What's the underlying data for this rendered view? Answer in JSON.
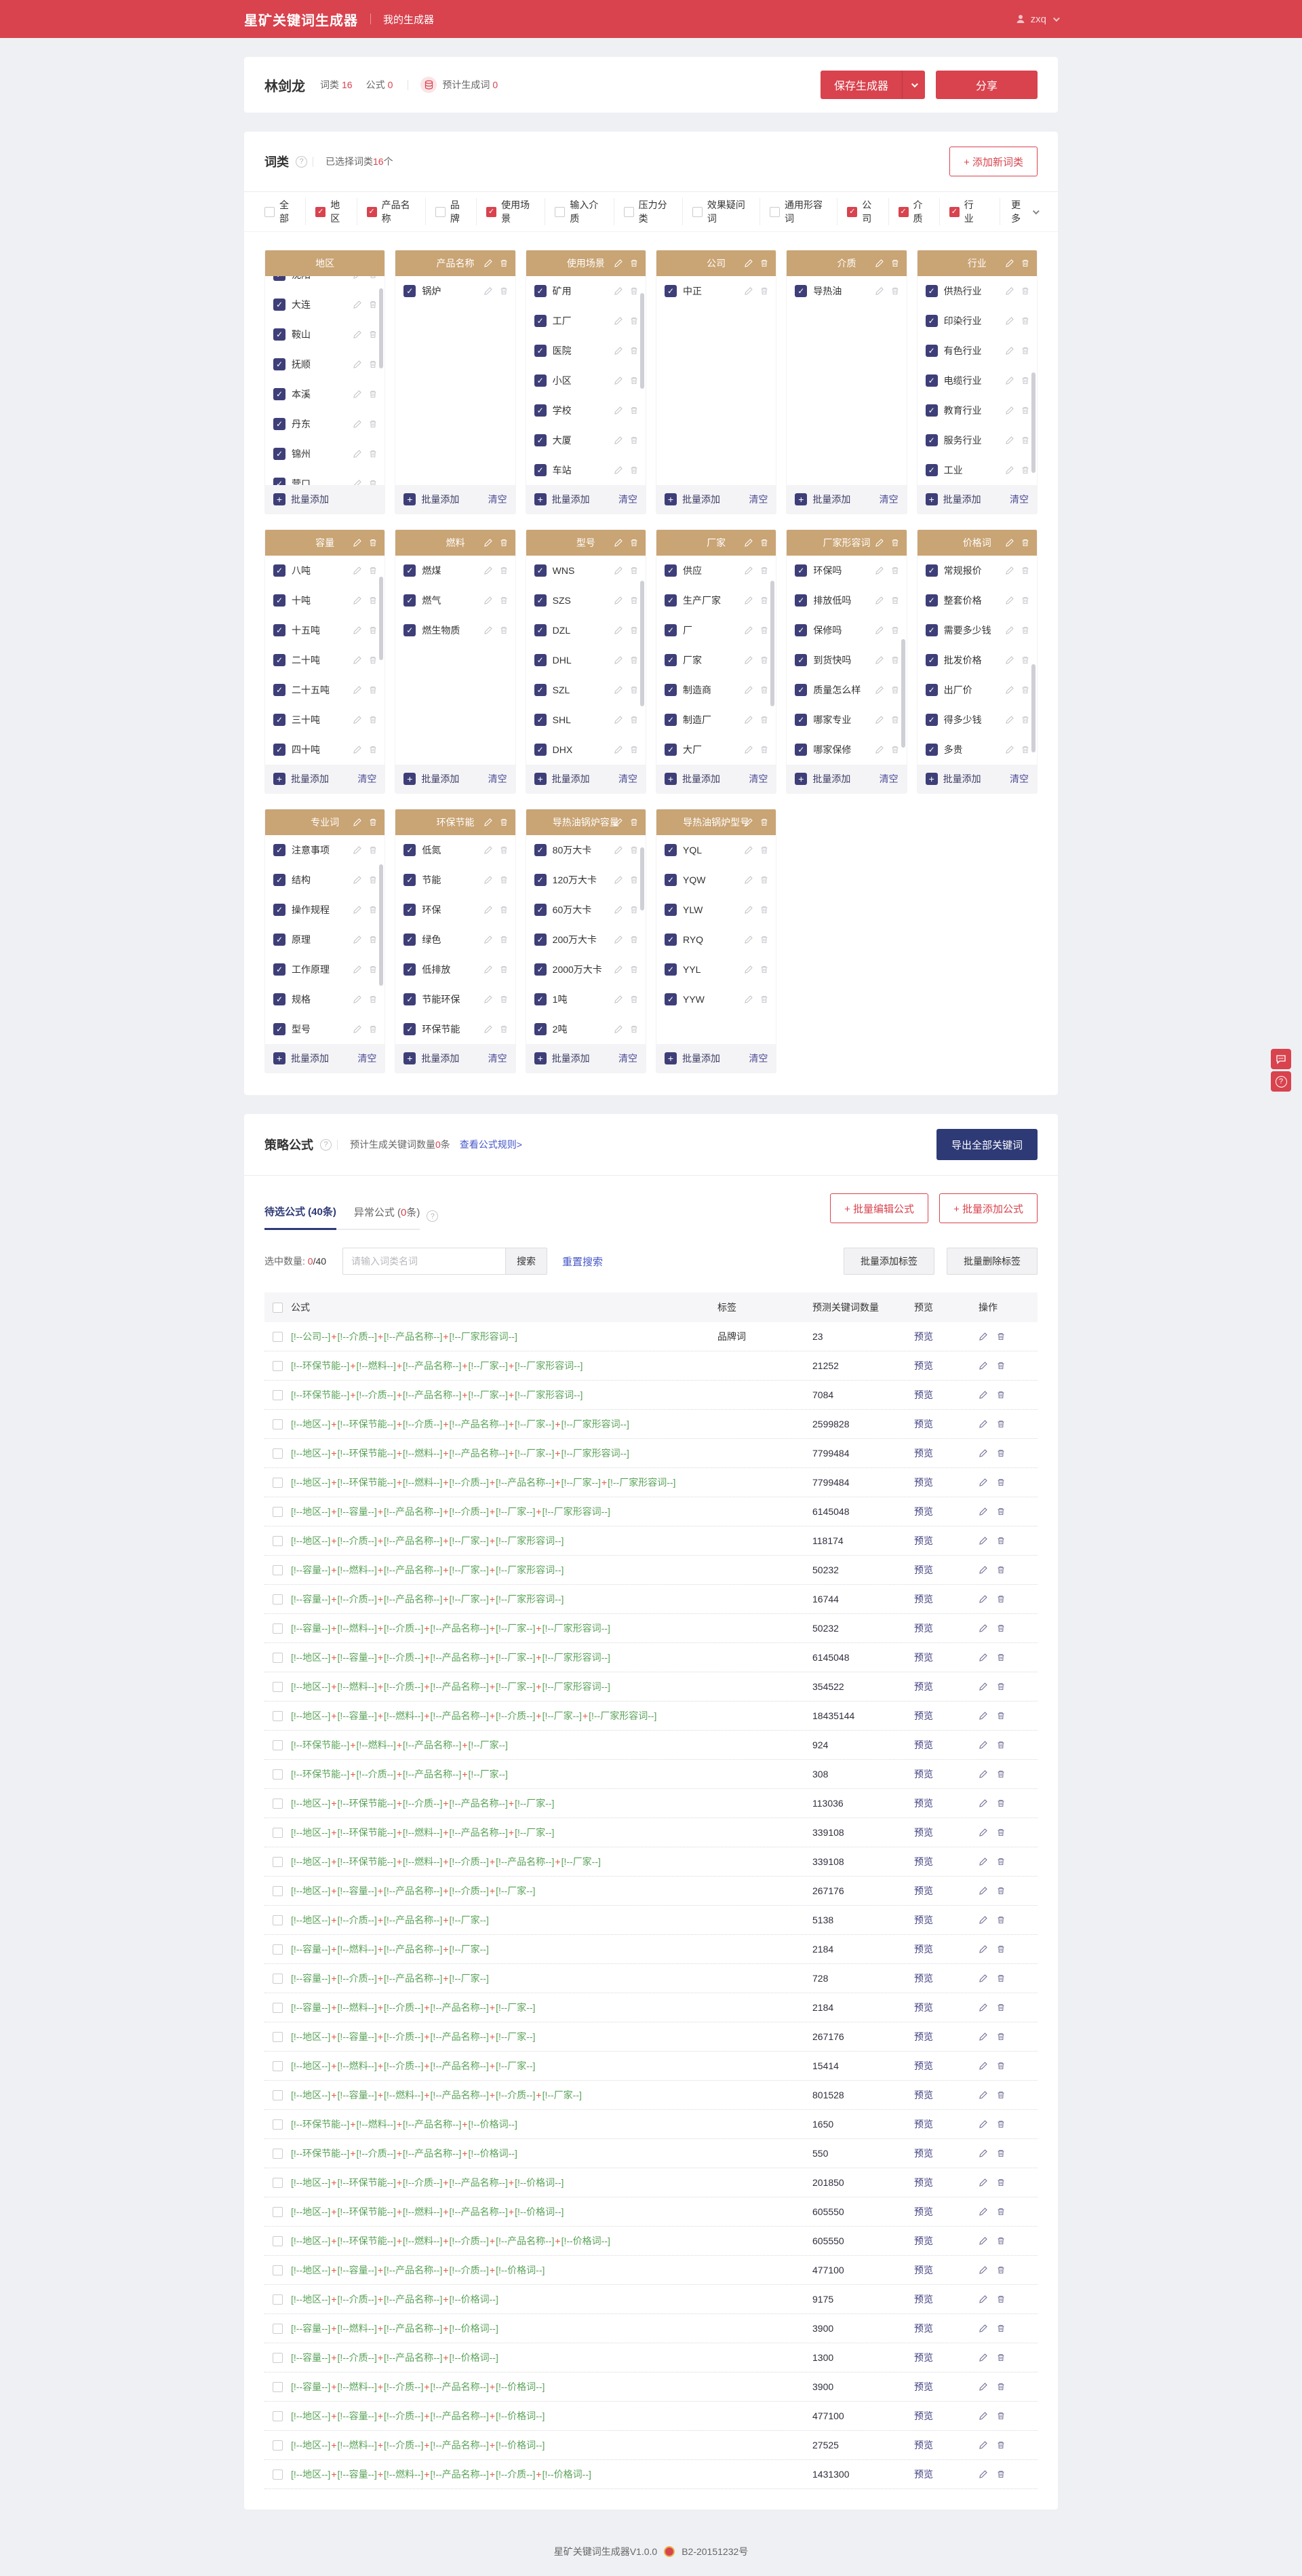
{
  "header": {
    "brand": "星矿关键词生成器",
    "nav": "我的生成器",
    "user": "zxq"
  },
  "userbar": {
    "name": "林剑龙",
    "stats": [
      {
        "label": "词类",
        "value": "16"
      },
      {
        "label": "公式",
        "value": "0"
      }
    ],
    "gen_label": "预计生成词",
    "gen_value": "0",
    "save": "保存生成器",
    "share": "分享"
  },
  "wordclass": {
    "title": "词类",
    "selected_prefix": "已选择词类",
    "selected_count": "16",
    "selected_suffix": "个",
    "add_button": "+ 添加新词类",
    "more": "更多",
    "batch_add": "批量添加",
    "clear": "清空",
    "filters": [
      {
        "label": "全部",
        "checked": false
      },
      {
        "label": "地区",
        "checked": true
      },
      {
        "label": "产品名称",
        "checked": true
      },
      {
        "label": "品牌",
        "checked": false
      },
      {
        "label": "使用场景",
        "checked": true
      },
      {
        "label": "输入介质",
        "checked": false
      },
      {
        "label": "压力分类",
        "checked": false
      },
      {
        "label": "效果疑问词",
        "checked": false
      },
      {
        "label": "通用形容词",
        "checked": false
      },
      {
        "label": "公司",
        "checked": true
      },
      {
        "label": "介质",
        "checked": true
      },
      {
        "label": "行业",
        "checked": true
      }
    ],
    "panels": [
      {
        "title": "地区",
        "items": [
          "沈阳",
          "大连",
          "鞍山",
          "抚顺",
          "本溪",
          "丹东",
          "锦州",
          "营口"
        ],
        "scroll": true,
        "thumb": [
          6,
          38
        ],
        "clear": false,
        "head_icons": false,
        "offset": -24
      },
      {
        "title": "产品名称",
        "items": [
          "锅炉"
        ],
        "scroll": false,
        "clear": true,
        "head_icons": true,
        "offset": 0
      },
      {
        "title": "使用场景",
        "items": [
          "矿用",
          "工厂",
          "医院",
          "小区",
          "学校",
          "大厦",
          "车站"
        ],
        "scroll": true,
        "thumb": [
          8,
          46
        ],
        "clear": true,
        "head_icons": true,
        "offset": 0
      },
      {
        "title": "公司",
        "items": [
          "中正"
        ],
        "scroll": false,
        "clear": true,
        "head_icons": true,
        "offset": 0
      },
      {
        "title": "介质",
        "items": [
          "导热油"
        ],
        "scroll": false,
        "clear": true,
        "head_icons": true,
        "offset": 0
      },
      {
        "title": "行业",
        "items": [
          "供热行业",
          "印染行业",
          "有色行业",
          "电缆行业",
          "教育行业",
          "服务行业",
          "工业"
        ],
        "scroll": true,
        "thumb": [
          46,
          48
        ],
        "clear": true,
        "head_icons": true,
        "offset": 0
      },
      {
        "title": "容量",
        "items": [
          "八吨",
          "十吨",
          "十五吨",
          "二十吨",
          "二十五吨",
          "三十吨",
          "四十吨"
        ],
        "scroll": true,
        "thumb": [
          10,
          40
        ],
        "clear": true,
        "head_icons": true,
        "offset": 0
      },
      {
        "title": "燃料",
        "items": [
          "燃煤",
          "燃气",
          "燃生物质"
        ],
        "scroll": false,
        "clear": true,
        "head_icons": true,
        "offset": 0
      },
      {
        "title": "型号",
        "items": [
          "WNS",
          "SZS",
          "DZL",
          "DHL",
          "SZL",
          "SHL",
          "DHX"
        ],
        "scroll": true,
        "thumb": [
          12,
          60
        ],
        "clear": true,
        "head_icons": true,
        "offset": 0
      },
      {
        "title": "厂家",
        "items": [
          "供应",
          "生产厂家",
          "厂",
          "厂家",
          "制造商",
          "制造厂",
          "大厂"
        ],
        "scroll": true,
        "thumb": [
          12,
          60
        ],
        "clear": true,
        "head_icons": true,
        "offset": 0
      },
      {
        "title": "厂家形容词",
        "items": [
          "环保吗",
          "排放低吗",
          "保修吗",
          "到货快吗",
          "质量怎么样",
          "哪家专业",
          "哪家保修"
        ],
        "scroll": true,
        "thumb": [
          40,
          52
        ],
        "clear": true,
        "head_icons": true,
        "offset": 0
      },
      {
        "title": "价格词",
        "items": [
          "常规报价",
          "整套价格",
          "需要多少钱",
          "批发价格",
          "出厂价",
          "得多少钱",
          "多贵"
        ],
        "scroll": true,
        "thumb": [
          52,
          42
        ],
        "clear": true,
        "head_icons": true,
        "offset": 0
      },
      {
        "title": "专业词",
        "items": [
          "注意事项",
          "结构",
          "操作规程",
          "原理",
          "工作原理",
          "规格",
          "型号"
        ],
        "scroll": true,
        "thumb": [
          14,
          58
        ],
        "clear": true,
        "head_icons": true,
        "offset": 0
      },
      {
        "title": "环保节能",
        "items": [
          "低氮",
          "节能",
          "环保",
          "绿色",
          "低排放",
          "节能环保",
          "环保节能"
        ],
        "scroll": false,
        "clear": true,
        "head_icons": true,
        "offset": 0
      },
      {
        "title": "导热油锅炉容量",
        "items": [
          "80万大卡",
          "120万大卡",
          "60万大卡",
          "200万大卡",
          "2000万大卡",
          "1吨",
          "2吨"
        ],
        "scroll": true,
        "thumb": [
          6,
          30
        ],
        "clear": true,
        "head_icons": true,
        "offset": 0
      },
      {
        "title": "导热油锅炉型号",
        "items": [
          "YQL",
          "YQW",
          "YLW",
          "RYQ",
          "YYL",
          "YYW"
        ],
        "scroll": false,
        "clear": true,
        "head_icons": true,
        "offset": 0
      }
    ]
  },
  "formula": {
    "title": "策略公式",
    "count_prefix": "预计生成关键词数量",
    "count_value": "0",
    "count_suffix": "条",
    "rules_link": "查看公式规则>",
    "export": "导出全部关键词",
    "tab1": "待选公式 (40条)",
    "tab2_prefix": "异常公式 (",
    "tab2_count": "0",
    "tab2_suffix": "条)",
    "batch_edit": "+ 批量编辑公式",
    "batch_add": "+ 批量添加公式",
    "selected_prefix": "选中数量: ",
    "selected_count": "0",
    "selected_total": "/40",
    "search_placeholder": "请输入词类名词",
    "search_button": "搜索",
    "reset_search": "重置搜索",
    "tag_add": "批量添加标签",
    "tag_del": "批量删除标签",
    "table": {
      "headers": [
        "公式",
        "标签",
        "预测关键词数量",
        "预览",
        "操作"
      ],
      "preview": "预览",
      "rows": [
        {
          "parts": [
            "公司",
            "介质",
            "产品名称",
            "厂家形容词"
          ],
          "tag": "品牌词",
          "count": "23"
        },
        {
          "parts": [
            "环保节能",
            "燃料",
            "产品名称",
            "厂家",
            "厂家形容词"
          ],
          "tag": "",
          "count": "21252"
        },
        {
          "parts": [
            "环保节能",
            "介质",
            "产品名称",
            "厂家",
            "厂家形容词"
          ],
          "tag": "",
          "count": "7084"
        },
        {
          "parts": [
            "地区",
            "环保节能",
            "介质",
            "产品名称",
            "厂家",
            "厂家形容词"
          ],
          "tag": "",
          "count": "2599828"
        },
        {
          "parts": [
            "地区",
            "环保节能",
            "燃料",
            "产品名称",
            "厂家",
            "厂家形容词"
          ],
          "tag": "",
          "count": "7799484"
        },
        {
          "parts": [
            "地区",
            "环保节能",
            "燃料",
            "介质",
            "产品名称",
            "厂家",
            "厂家形容词"
          ],
          "tag": "",
          "count": "7799484"
        },
        {
          "parts": [
            "地区",
            "容量",
            "产品名称",
            "介质",
            "厂家",
            "厂家形容词"
          ],
          "tag": "",
          "count": "6145048"
        },
        {
          "parts": [
            "地区",
            "介质",
            "产品名称",
            "厂家",
            "厂家形容词"
          ],
          "tag": "",
          "count": "118174"
        },
        {
          "parts": [
            "容量",
            "燃料",
            "产品名称",
            "厂家",
            "厂家形容词"
          ],
          "tag": "",
          "count": "50232"
        },
        {
          "parts": [
            "容量",
            "介质",
            "产品名称",
            "厂家",
            "厂家形容词"
          ],
          "tag": "",
          "count": "16744"
        },
        {
          "parts": [
            "容量",
            "燃料",
            "介质",
            "产品名称",
            "厂家",
            "厂家形容词"
          ],
          "tag": "",
          "count": "50232"
        },
        {
          "parts": [
            "地区",
            "容量",
            "介质",
            "产品名称",
            "厂家",
            "厂家形容词"
          ],
          "tag": "",
          "count": "6145048"
        },
        {
          "parts": [
            "地区",
            "燃料",
            "介质",
            "产品名称",
            "厂家",
            "厂家形容词"
          ],
          "tag": "",
          "count": "354522"
        },
        {
          "parts": [
            "地区",
            "容量",
            "燃料",
            "产品名称",
            "介质",
            "厂家",
            "厂家形容词"
          ],
          "tag": "",
          "count": "18435144"
        },
        {
          "parts": [
            "环保节能",
            "燃料",
            "产品名称",
            "厂家"
          ],
          "tag": "",
          "count": "924"
        },
        {
          "parts": [
            "环保节能",
            "介质",
            "产品名称",
            "厂家"
          ],
          "tag": "",
          "count": "308"
        },
        {
          "parts": [
            "地区",
            "环保节能",
            "介质",
            "产品名称",
            "厂家"
          ],
          "tag": "",
          "count": "113036"
        },
        {
          "parts": [
            "地区",
            "环保节能",
            "燃料",
            "产品名称",
            "厂家"
          ],
          "tag": "",
          "count": "339108"
        },
        {
          "parts": [
            "地区",
            "环保节能",
            "燃料",
            "介质",
            "产品名称",
            "厂家"
          ],
          "tag": "",
          "count": "339108"
        },
        {
          "parts": [
            "地区",
            "容量",
            "产品名称",
            "介质",
            "厂家"
          ],
          "tag": "",
          "count": "267176"
        },
        {
          "parts": [
            "地区",
            "介质",
            "产品名称",
            "厂家"
          ],
          "tag": "",
          "count": "5138"
        },
        {
          "parts": [
            "容量",
            "燃料",
            "产品名称",
            "厂家"
          ],
          "tag": "",
          "count": "2184"
        },
        {
          "parts": [
            "容量",
            "介质",
            "产品名称",
            "厂家"
          ],
          "tag": "",
          "count": "728"
        },
        {
          "parts": [
            "容量",
            "燃料",
            "介质",
            "产品名称",
            "厂家"
          ],
          "tag": "",
          "count": "2184"
        },
        {
          "parts": [
            "地区",
            "容量",
            "介质",
            "产品名称",
            "厂家"
          ],
          "tag": "",
          "count": "267176"
        },
        {
          "parts": [
            "地区",
            "燃料",
            "介质",
            "产品名称",
            "厂家"
          ],
          "tag": "",
          "count": "15414"
        },
        {
          "parts": [
            "地区",
            "容量",
            "燃料",
            "产品名称",
            "介质",
            "厂家"
          ],
          "tag": "",
          "count": "801528"
        },
        {
          "parts": [
            "环保节能",
            "燃料",
            "产品名称",
            "价格词"
          ],
          "tag": "",
          "count": "1650"
        },
        {
          "parts": [
            "环保节能",
            "介质",
            "产品名称",
            "价格词"
          ],
          "tag": "",
          "count": "550"
        },
        {
          "parts": [
            "地区",
            "环保节能",
            "介质",
            "产品名称",
            "价格词"
          ],
          "tag": "",
          "count": "201850"
        },
        {
          "parts": [
            "地区",
            "环保节能",
            "燃料",
            "产品名称",
            "价格词"
          ],
          "tag": "",
          "count": "605550"
        },
        {
          "parts": [
            "地区",
            "环保节能",
            "燃料",
            "介质",
            "产品名称",
            "价格词"
          ],
          "tag": "",
          "count": "605550"
        },
        {
          "parts": [
            "地区",
            "容量",
            "产品名称",
            "介质",
            "价格词"
          ],
          "tag": "",
          "count": "477100"
        },
        {
          "parts": [
            "地区",
            "介质",
            "产品名称",
            "价格词"
          ],
          "tag": "",
          "count": "9175"
        },
        {
          "parts": [
            "容量",
            "燃料",
            "产品名称",
            "价格词"
          ],
          "tag": "",
          "count": "3900"
        },
        {
          "parts": [
            "容量",
            "介质",
            "产品名称",
            "价格词"
          ],
          "tag": "",
          "count": "1300"
        },
        {
          "parts": [
            "容量",
            "燃料",
            "介质",
            "产品名称",
            "价格词"
          ],
          "tag": "",
          "count": "3900"
        },
        {
          "parts": [
            "地区",
            "容量",
            "介质",
            "产品名称",
            "价格词"
          ],
          "tag": "",
          "count": "477100"
        },
        {
          "parts": [
            "地区",
            "燃料",
            "介质",
            "产品名称",
            "价格词"
          ],
          "tag": "",
          "count": "27525"
        },
        {
          "parts": [
            "地区",
            "容量",
            "燃料",
            "产品名称",
            "介质",
            "价格词"
          ],
          "tag": "",
          "count": "1431300"
        }
      ]
    }
  },
  "footer": {
    "version": "星矿关键词生成器V1.0.0",
    "license": "B2-20151232号"
  },
  "floating": {
    "help": "?"
  }
}
